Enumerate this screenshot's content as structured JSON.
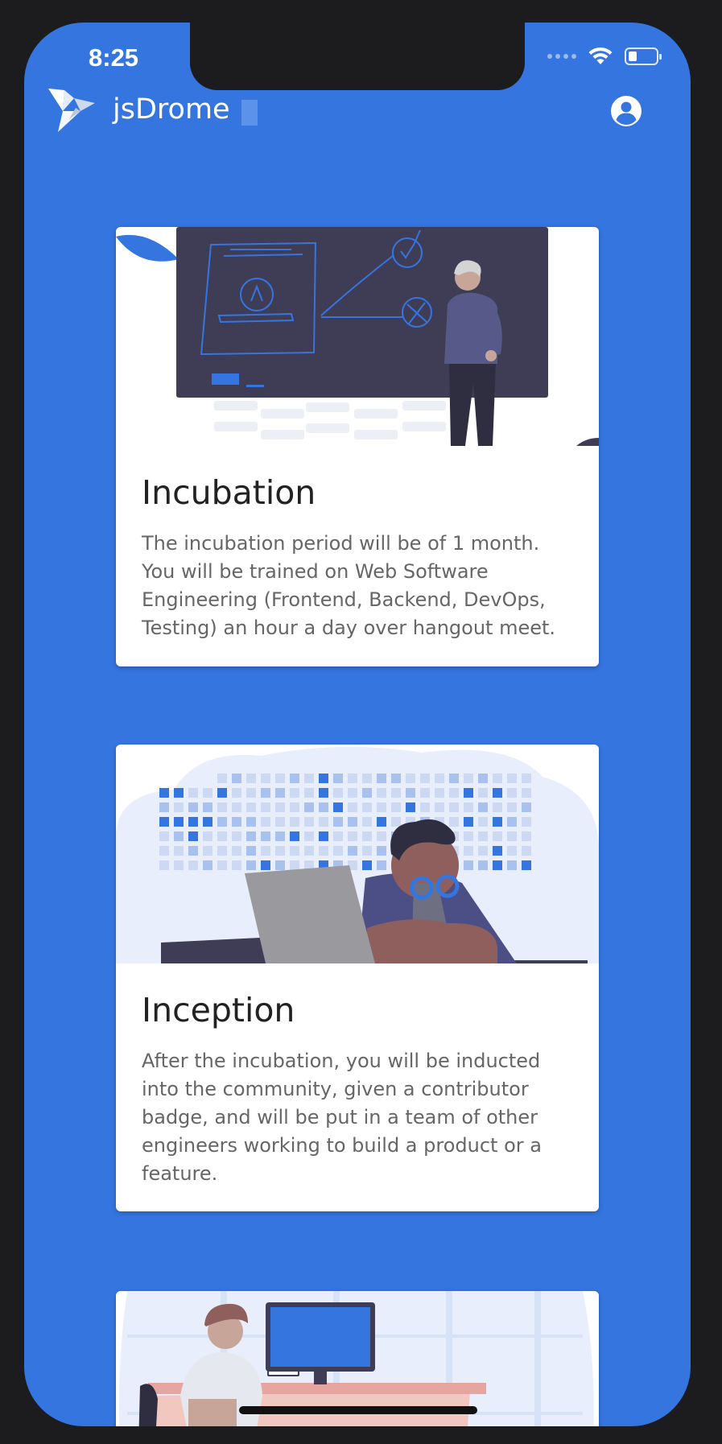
{
  "status_bar": {
    "time": "8:25"
  },
  "app": {
    "title": "jsDrome"
  },
  "cards": [
    {
      "title": "Incubation",
      "body": "The incubation period will be of 1 month. You will be trained on Web Software Engineering (Frontend, Backend, DevOps, Testing) an hour a day over hangout meet."
    },
    {
      "title": "Inception",
      "body": "After the incubation, you will be inducted into the community, given a contributor badge, and will be put in a team of other engineers working to build a product or a feature."
    }
  ],
  "colors": {
    "primary": "#3575e0",
    "frame": "#1c1c1e",
    "card": "#ffffff"
  },
  "icons": {
    "logo": "origami-bird-icon",
    "account": "account-circle-icon",
    "wifi": "wifi-icon",
    "battery": "battery-icon"
  }
}
